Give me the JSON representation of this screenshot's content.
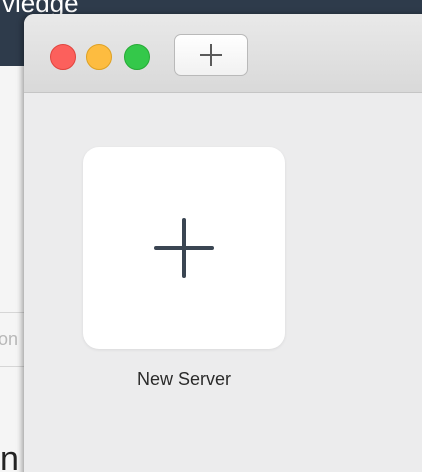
{
  "background_app": {
    "header_text": "vledge",
    "side_placeholder": "on",
    "side_letter": "n"
  },
  "window": {
    "toolbar": {
      "add_tab_icon": "plus-icon"
    },
    "tiles": [
      {
        "icon": "plus-icon",
        "label": "New Server"
      }
    ]
  },
  "colors": {
    "close": "#fc605c",
    "minimize": "#fdbc40",
    "maximize": "#34c84a",
    "background_header": "#2e3b4b",
    "window_bg": "#ececed"
  }
}
